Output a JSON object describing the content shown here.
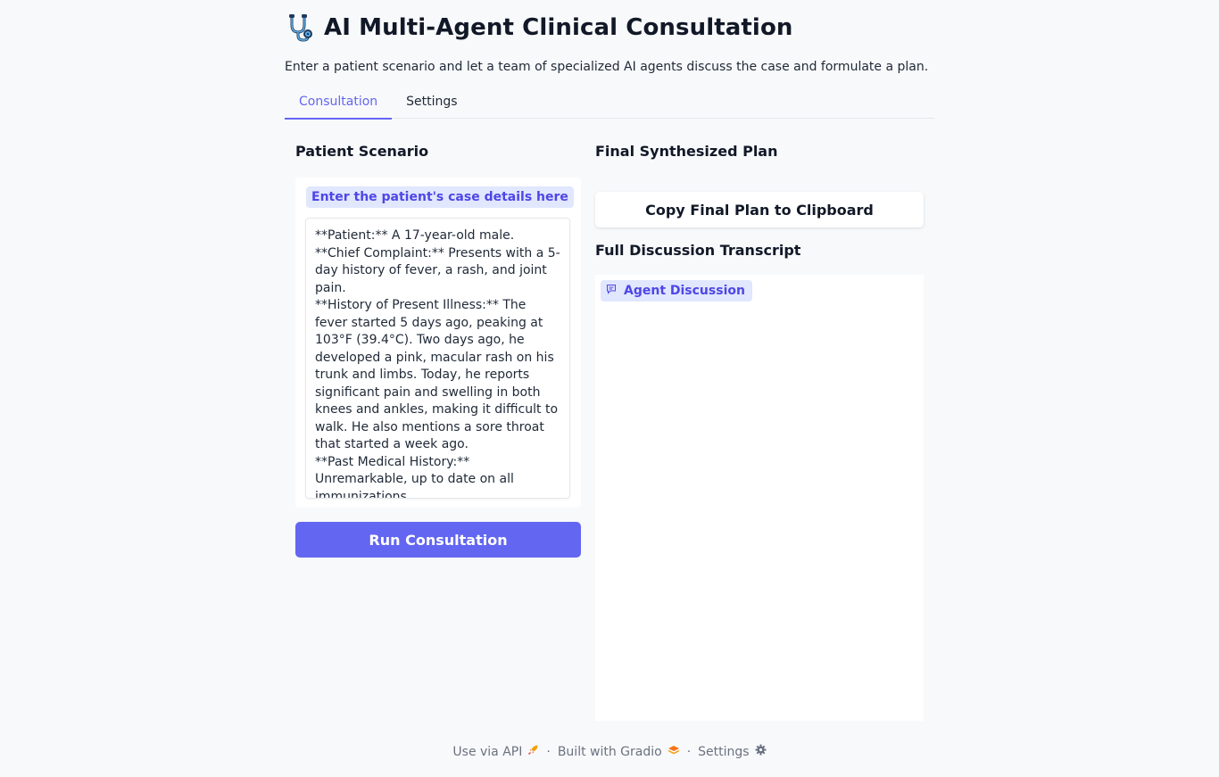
{
  "header": {
    "title": "AI Multi-Agent Clinical Consultation",
    "icon": "stethoscope-icon",
    "subtitle": "Enter a patient scenario and let a team of specialized AI agents discuss the case and formulate a plan."
  },
  "tabs": [
    {
      "label": "Consultation",
      "active": true
    },
    {
      "label": "Settings",
      "active": false
    }
  ],
  "left": {
    "section_title": "Patient Scenario",
    "input_label": "Enter the patient's case details here",
    "scenario_text": "**Patient:** A 17-year-old male.\n**Chief Complaint:** Presents with a 5-day history of fever, a rash, and joint pain.\n**History of Present Illness:** The fever started 5 days ago, peaking at 103°F (39.4°C). Two days ago, he developed a pink, macular rash on his trunk and limbs. Today, he reports significant pain and swelling in both knees and ankles, making it difficult to walk. He also mentions a sore throat that started a week ago.\n**Past Medical History:** Unremarkable, up to date on all immunizations.",
    "run_button": "Run Consultation"
  },
  "right": {
    "plan_title": "Final Synthesized Plan",
    "copy_button": "Copy Final Plan to Clipboard",
    "transcript_title": "Full Discussion Transcript",
    "chatbot_label": "Agent Discussion"
  },
  "footer": {
    "api": "Use via API",
    "gradio": "Built with Gradio",
    "settings": "Settings",
    "separator": "·"
  },
  "colors": {
    "accent": "#6366f1",
    "background": "#f8f9fb",
    "chip_bg": "#e0e7ff"
  }
}
